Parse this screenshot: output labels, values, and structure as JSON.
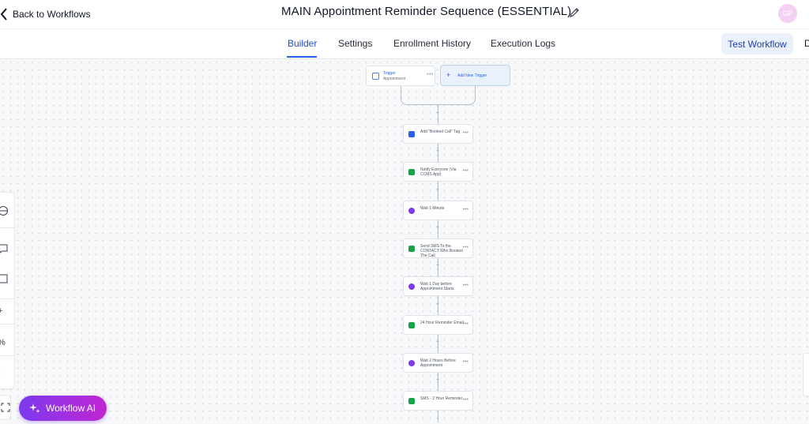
{
  "header": {
    "back_label": "Back to Workflows",
    "title": "MAIN Appointment Reminder Sequence (ESSENTIAL)",
    "avatar_initials": "GP"
  },
  "tabs": [
    "Builder",
    "Settings",
    "Enrollment History",
    "Execution Logs"
  ],
  "active_tab": "Builder",
  "test_button": "Test Workflow",
  "cut_label": "D",
  "trigger": {
    "title": "Trigger",
    "subtitle": "Appointment",
    "add_label": "Add New Trigger"
  },
  "steps": [
    {
      "label": "Add \"Booked Call\" Tag",
      "icon": "tag-icon",
      "color": "#2563eb"
    },
    {
      "label": "Notify Everyone (Via CCMS App)",
      "icon": "bell-icon",
      "color": "#16a34a"
    },
    {
      "label": "Wait 1 Minute",
      "icon": "clock-icon",
      "color": "#7c3aed"
    },
    {
      "label": "Send SMS To the CONTACT Who Booked The Call",
      "icon": "sms-icon",
      "color": "#16a34a"
    },
    {
      "label": "Wait 1 Day before Appointment Starts",
      "icon": "clock-icon",
      "color": "#7c3aed"
    },
    {
      "label": "24 Hour Reminder Email",
      "icon": "email-icon",
      "color": "#16a34a"
    },
    {
      "label": "Wait 2 Hours Before Appointment",
      "icon": "clock-icon",
      "color": "#7c3aed"
    },
    {
      "label": "SMS - 2 Hour Reminder",
      "icon": "sms-icon",
      "color": "#16a34a"
    }
  ],
  "sidebar": {
    "zoom_in": "+",
    "zoom_level": "%",
    "zoom_out": "-"
  },
  "ai_button": "Workflow AI"
}
